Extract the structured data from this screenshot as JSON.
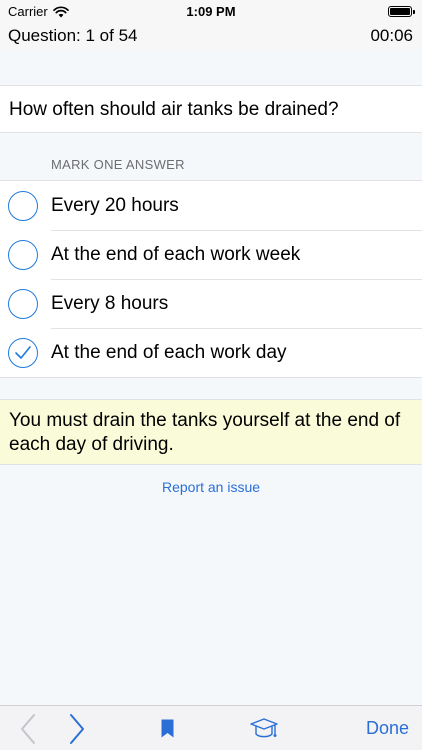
{
  "status_bar": {
    "carrier": "Carrier",
    "time": "1:09 PM"
  },
  "header": {
    "question_counter": "Question: 1 of 54",
    "timer": "00:06"
  },
  "question": {
    "text": "How often should air tanks be drained?"
  },
  "answers_section": {
    "label": "MARK ONE ANSWER",
    "options": [
      {
        "text": "Every 20 hours",
        "selected": false
      },
      {
        "text": "At the end of each work week",
        "selected": false
      },
      {
        "text": "Every 8 hours",
        "selected": false
      },
      {
        "text": "At the end of each work day",
        "selected": true
      }
    ]
  },
  "explanation": {
    "text": "You must drain the tanks yourself at the end of each day of driving."
  },
  "report_link": {
    "label": "Report an issue"
  },
  "toolbar": {
    "done_label": "Done",
    "prev_icon": "chevron-left-icon",
    "next_icon": "chevron-right-icon",
    "bookmark_icon": "bookmark-icon",
    "learn_icon": "graduation-cap-icon"
  },
  "colors": {
    "accent": "#1e7ae0",
    "link": "#2b6fd6",
    "explanation_bg": "#fafbd9",
    "background": "#f4f8fb"
  }
}
